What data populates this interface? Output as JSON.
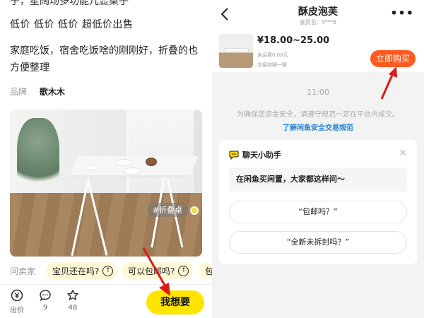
{
  "left": {
    "clipped_line": "子，星阔场多功能几显桌子",
    "desc_line1": "低价  低价  低价  超低价出售",
    "desc_line2": "家庭吃饭，宿舍吃饭啥的刚刚好，折叠的也方便整理",
    "brand_label": "品牌",
    "brand_value": "歌木木",
    "photo_tag": "#折叠桌",
    "ask_label": "问卖家",
    "chips": [
      "宝贝还在吗?",
      "可以包邮吗?",
      "包"
    ],
    "bottom": {
      "bid_label": "出价",
      "comment_count": "9",
      "favorite_count": "48",
      "want_label": "我想要"
    }
  },
  "right": {
    "title": "酥皮泡芙",
    "subtitle": "会员名：t***8",
    "item": {
      "price": "¥18.00~25.00",
      "shipping": "含运费0.00元",
      "chat_first": "交易前聊一聊",
      "buy_label": "立即购买"
    },
    "time": "11:00",
    "notice": "为确保您资金安全，请遵守规范一定在平台内成交。",
    "notice_link": "了解闲鱼安全交易规范",
    "assistant": {
      "title": "聊天小助手",
      "question": "在闲鱼买闲置，大家都这样问～",
      "options": [
        "“包邮吗？”",
        "“全新未拆封吗？”"
      ]
    }
  },
  "colors": {
    "yellow": "#ffe400",
    "buy_orange": "#ff5a1f",
    "link_blue": "#1d7fd8",
    "annotation_red": "#e01818"
  }
}
